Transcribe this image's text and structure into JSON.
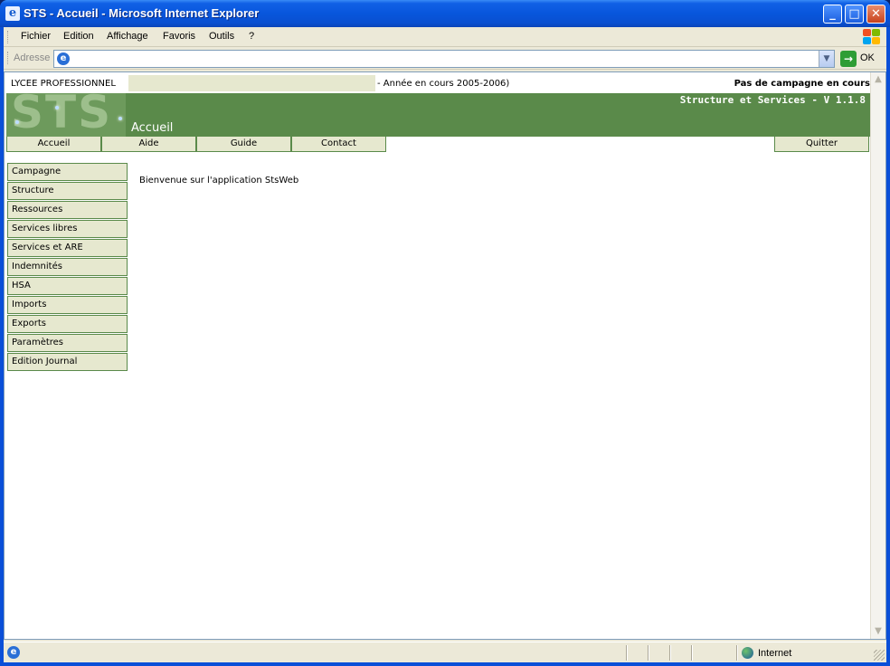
{
  "window": {
    "title": "STS - Accueil - Microsoft Internet Explorer",
    "minimize": "_",
    "maximize": "□",
    "close": "✕"
  },
  "menubar": {
    "items": [
      "Fichier",
      "Edition",
      "Affichage",
      "Favoris",
      "Outils",
      "?"
    ]
  },
  "addressbar": {
    "label": "Adresse",
    "value": "",
    "go_label": "OK"
  },
  "page": {
    "school_label": "LYCEE PROFESSIONNEL",
    "year_text": "- Année en cours 2005-2006)",
    "campaign_status": "Pas de campagne en cours",
    "logo_text": "STS",
    "page_title": "Accueil",
    "app_name": "Structure et Services - V 1.1.8",
    "topnav": [
      "Accueil",
      "Aide",
      "Guide",
      "Contact"
    ],
    "quit_label": "Quitter",
    "sidenav": [
      "Campagne",
      "Structure",
      "Ressources",
      "Services libres",
      "Services et ARE",
      "Indemnités",
      "HSA",
      "Imports",
      "Exports",
      "Paramètres",
      "Edition Journal"
    ],
    "welcome": "Bienvenue sur l'application StsWeb"
  },
  "statusbar": {
    "zone": "Internet"
  },
  "colors": {
    "banner": "#5a8a4a",
    "nav_bg": "#e6e8cf",
    "nav_border": "#5a8a4a"
  }
}
